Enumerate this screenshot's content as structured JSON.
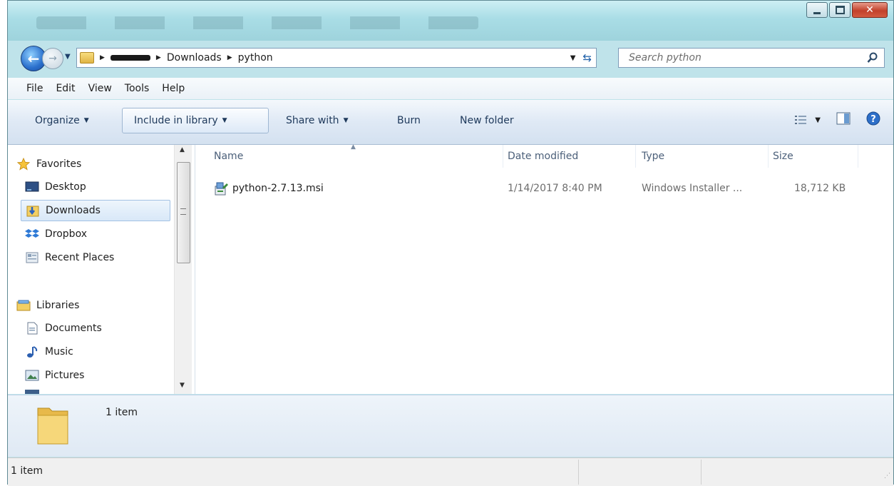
{
  "window": {
    "caption_buttons": [
      "minimize-icon",
      "maximize-icon",
      "close-icon"
    ]
  },
  "address": {
    "crumbs": [
      "Downloads",
      "python"
    ],
    "search_placeholder": "Search python"
  },
  "menubar": {
    "items": [
      "File",
      "Edit",
      "View",
      "Tools",
      "Help"
    ]
  },
  "commandbar": {
    "organize": "Organize",
    "include": "Include in library",
    "share": "Share with",
    "burn": "Burn",
    "newfolder": "New folder"
  },
  "nav": {
    "favorites": "Favorites",
    "desktop": "Desktop",
    "downloads": "Downloads",
    "dropbox": "Dropbox",
    "recent": "Recent Places",
    "libraries": "Libraries",
    "documents": "Documents",
    "music": "Music",
    "pictures": "Pictures"
  },
  "columns": {
    "name": "Name",
    "date": "Date modified",
    "type": "Type",
    "size": "Size"
  },
  "files": [
    {
      "name": "python-2.7.13.msi",
      "date": "1/14/2017 8:40 PM",
      "type": "Windows Installer ...",
      "size": "18,712 KB"
    }
  ],
  "details": {
    "count": "1 item"
  },
  "status": {
    "count": "1 item"
  }
}
